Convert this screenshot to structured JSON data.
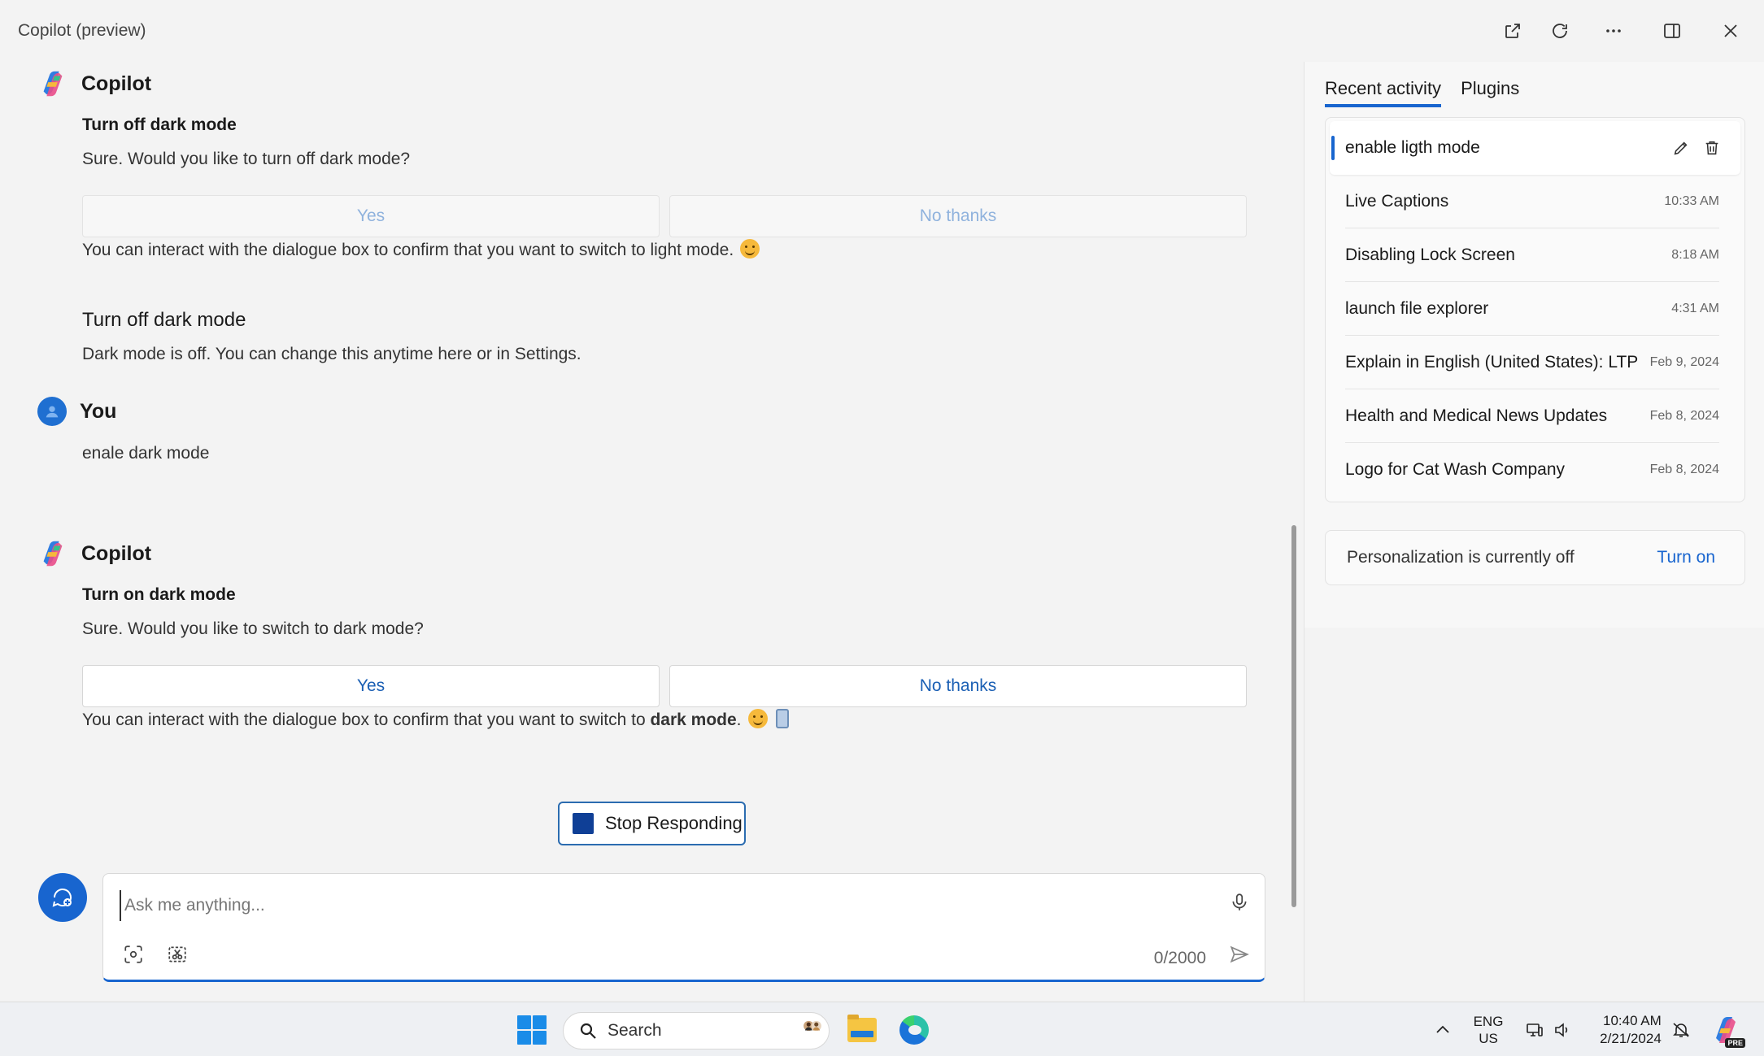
{
  "window": {
    "title": "Copilot (preview)"
  },
  "chat": {
    "messages": [
      {
        "sender": "Copilot",
        "card_title": "Turn off dark mode",
        "text": "Sure. Would you like to turn off dark mode?",
        "yes_label": "Yes",
        "no_label": "No thanks",
        "followup": "You can interact with the dialogue box to confirm that you want to switch to light mode."
      },
      {
        "sender": "",
        "card_title": "Turn off dark mode",
        "text": "Dark mode is off. You can change this anytime here or in Settings."
      },
      {
        "sender": "You",
        "text": "enale dark mode"
      },
      {
        "sender": "Copilot",
        "card_title": "Turn on dark mode",
        "text": "Sure. Would you like to switch to dark mode?",
        "yes_label": "Yes",
        "no_label": "No thanks",
        "followup_prefix": "You can interact with the dialogue box to confirm that you want to switch to ",
        "followup_bold": "dark mode",
        "followup_suffix": "."
      }
    ],
    "stop_label": "Stop Responding",
    "input": {
      "placeholder": "Ask me anything...",
      "value": "",
      "char_count": "0/2000"
    }
  },
  "sidebar": {
    "tabs": [
      {
        "label": "Recent activity",
        "active": true
      },
      {
        "label": "Plugins",
        "active": false
      }
    ],
    "activity": [
      {
        "title": "enable ligth mode",
        "time": "",
        "selected": true
      },
      {
        "title": "Live Captions",
        "time": "10:33 AM"
      },
      {
        "title": "Disabling Lock Screen",
        "time": "8:18 AM"
      },
      {
        "title": "launch file explorer",
        "time": "4:31 AM"
      },
      {
        "title": "Explain in English (United States): LTPO",
        "time": "Feb 9, 2024"
      },
      {
        "title": "Health and Medical News Updates",
        "time": "Feb 8, 2024"
      },
      {
        "title": "Logo for Cat Wash Company",
        "time": "Feb 8, 2024"
      }
    ],
    "personalization": {
      "text": "Personalization is currently off",
      "action": "Turn on"
    }
  },
  "taskbar": {
    "search_label": "Search",
    "language": {
      "line1": "ENG",
      "line2": "US"
    },
    "clock": {
      "time": "10:40 AM",
      "date": "2/21/2024"
    },
    "copilot_badge": "PRE"
  },
  "colors": {
    "accent": "#1865cf",
    "stop": "#0f3f96"
  }
}
